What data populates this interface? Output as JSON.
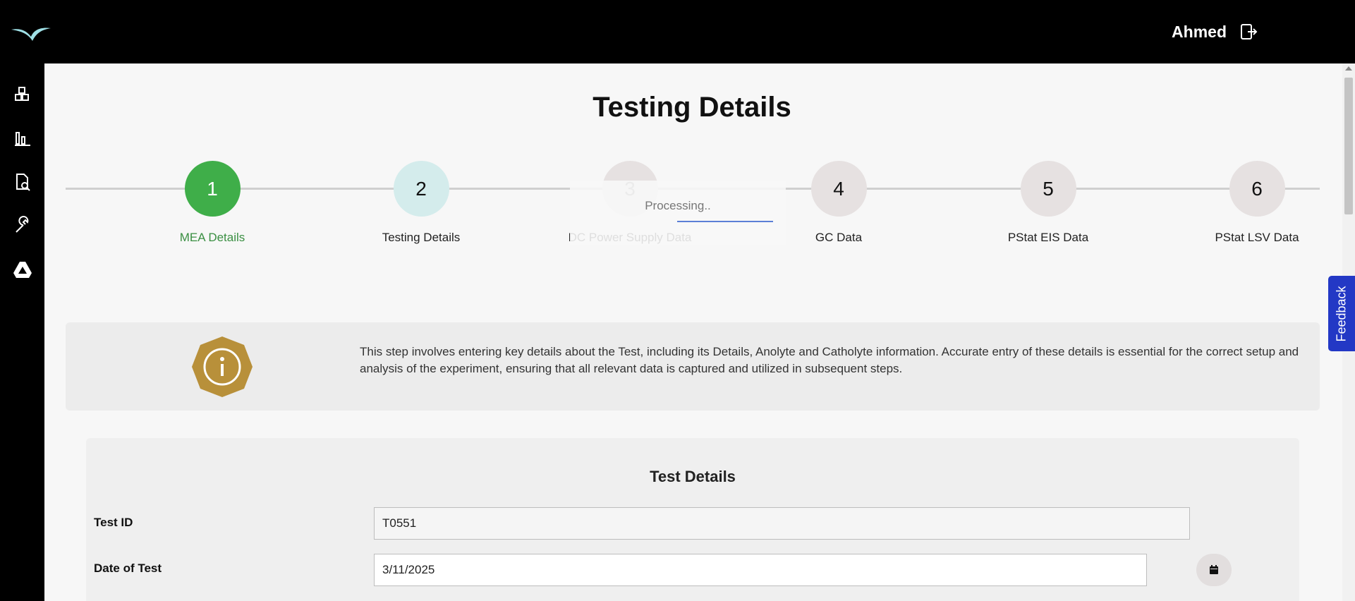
{
  "header": {
    "user_name": "Ahmed",
    "logo_icon": "bird-logo-icon",
    "logout_icon": "logout-icon"
  },
  "sidebar": {
    "items": [
      {
        "icon": "dashboard-icon"
      },
      {
        "icon": "bar-chart-icon"
      },
      {
        "icon": "document-search-icon"
      },
      {
        "icon": "wrench-icon"
      },
      {
        "icon": "google-drive-icon"
      }
    ]
  },
  "page": {
    "title": "Testing Details"
  },
  "stepper": {
    "steps": [
      {
        "number": "1",
        "label": "MEA Details"
      },
      {
        "number": "2",
        "label": "Testing Details"
      },
      {
        "number": "3",
        "label": "DC Power Supply Data"
      },
      {
        "number": "4",
        "label": "GC Data"
      },
      {
        "number": "5",
        "label": "PStat EIS Data"
      },
      {
        "number": "6",
        "label": "PStat LSV Data"
      }
    ]
  },
  "overlay": {
    "processing_text": "Processing.."
  },
  "info": {
    "text": "This step involves entering key details about the Test, including its Details, Anolyte and Catholyte information. Accurate entry of these details is essential for the correct setup and analysis of the experiment, ensuring that all relevant data is captured and utilized in subsequent steps."
  },
  "form": {
    "title": "Test Details",
    "test_id_label": "Test ID",
    "test_id_value": "T0551",
    "date_label": "Date of Test",
    "date_value": "3/11/2025"
  },
  "feedback": {
    "label": "Feedback"
  },
  "colors": {
    "active_step": "#3fae49",
    "current_step": "#d4ecec",
    "info_badge": "#b8903a",
    "feedback": "#2338c5"
  }
}
